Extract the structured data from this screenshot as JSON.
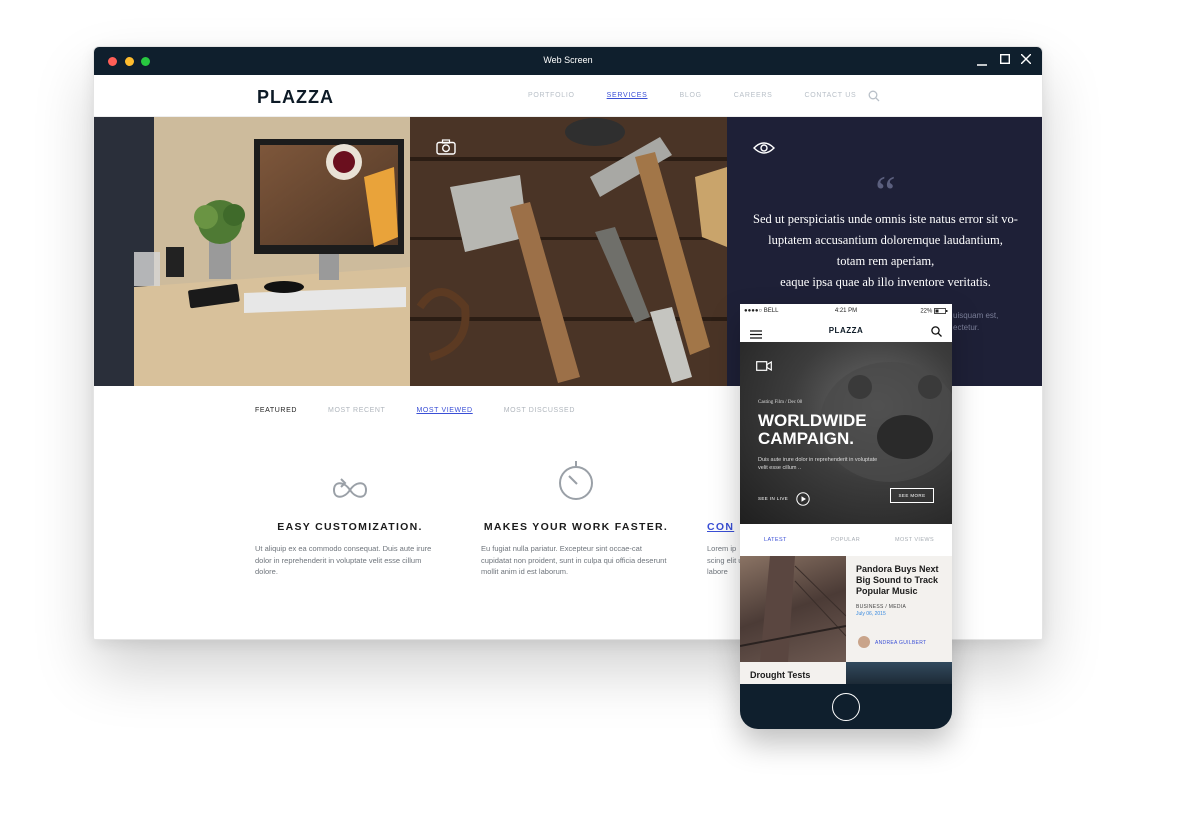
{
  "window": {
    "title": "Web Screen",
    "minimize": "_",
    "maximize": "□",
    "close": "×"
  },
  "site": {
    "logo": "PLAZZA",
    "nav": [
      "PORTFOLIO",
      "SERVICES",
      "BLOG",
      "CAREERS",
      "CONTACT US"
    ],
    "active_nav": "SERVICES"
  },
  "quote": {
    "mark": "“",
    "lines": [
      "Sed ut perspiciatis unde omnis iste natus error sit vo-",
      "luptatem accusantium doloremque laudantium,",
      "totam rem aperiam,",
      "eaque ipsa quae ab illo inventore veritatis."
    ],
    "sub_lines": [
      "uisquam est,",
      "ectetur."
    ]
  },
  "tabs": [
    "FEATURED",
    "MOST RECENT",
    "MOST VIEWED",
    "MOST DISCUSSED"
  ],
  "features": [
    {
      "title": "EASY CUSTOMIZATION.",
      "text": "Ut aliquip ex ea commodo consequat. Duis aute irure dolor in reprehenderit in voluptate velit esse cillum dolore."
    },
    {
      "title": "MAKES YOUR WORK FASTER.",
      "text": "Eu fugiat nulla pariatur. Excepteur sint occae-cat cupidatat non proident, sunt in culpa qui officia deserunt mollit anim id est laborum."
    },
    {
      "title": "CON",
      "text": "Lorem ip scing elit ut labore"
    }
  ],
  "phone": {
    "carrier": "●●●●○ BELL",
    "time": "4:21 PM",
    "battery": "22%",
    "logo": "PLAZZA",
    "hero": {
      "category": "Casting Film / Dec 08",
      "title_line1": "WORLDWIDE",
      "title_line2": "CAMPAIGN.",
      "desc": "Duis aute irure dolor in reprehenderit in voluptate velit esse cillum ..",
      "see_live": "SEE IN LIVE",
      "see_more": "SEE MORE"
    },
    "tabs": [
      "LATEST",
      "POPULAR",
      "MOST VIEWS"
    ],
    "card": {
      "title": "Pandora Buys Next Big Sound to Track Popular Music",
      "meta": "BUSINESS / MEDIA",
      "date": "July 06, 2015",
      "author": "ANDREA GUILBERT"
    },
    "card2_title": "Drought Tests"
  }
}
